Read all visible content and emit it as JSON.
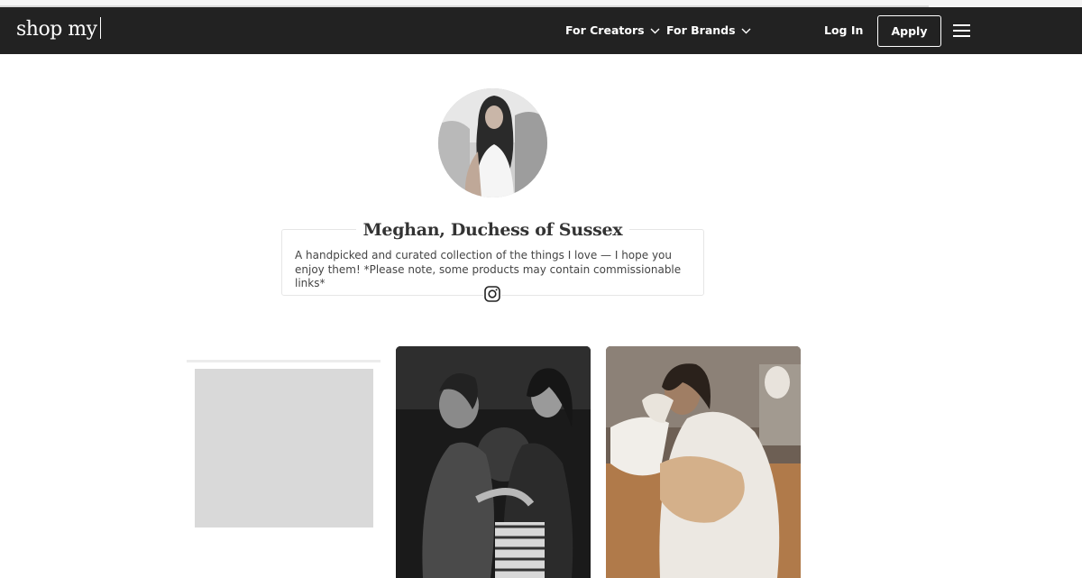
{
  "header": {
    "logo_text": "shop my",
    "nav": [
      {
        "label": "For Creators",
        "icon": "chevron-down-icon"
      },
      {
        "label": "For Brands",
        "icon": "chevron-down-icon"
      }
    ],
    "login_label": "Log In",
    "apply_label": "Apply",
    "menu_icon": "hamburger-menu-icon"
  },
  "profile": {
    "name": "Meghan, Duchess of Sussex",
    "bio": "A handpicked and curated collection of the things I love — I hope you enjoy them! *Please note, some products may contain commissionable links*",
    "social_icon": "instagram-icon"
  },
  "colors": {
    "nav_background": "#222222",
    "page_background": "#ffffff",
    "placeholder": "#d9d9d9"
  }
}
